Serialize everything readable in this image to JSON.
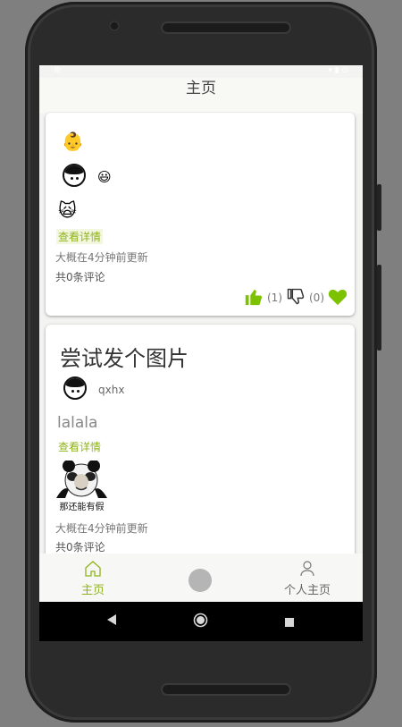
{
  "app": {
    "title": "主页"
  },
  "feed": [
    {
      "title_emoji": "👶",
      "author_emoji": "😃",
      "content_emoji": "🙀",
      "detail_link": "查看详情",
      "updated": "大概在4分钟前更新",
      "comments": "共0条评论",
      "likes_count": "(1)",
      "dislikes_count": "(0)"
    },
    {
      "title": "尝试发个图片",
      "username": "qxhx",
      "body": "lalala",
      "detail_link": "查看详情",
      "image_caption": "那还能有假",
      "updated": "大概在4分钟前更新",
      "comments": "共0条评论"
    }
  ],
  "nav": {
    "home_label": "主页",
    "profile_label": "个人主页"
  },
  "colors": {
    "accent": "#8fb31c",
    "heart": "#7cc200",
    "inactive": "#777777"
  }
}
